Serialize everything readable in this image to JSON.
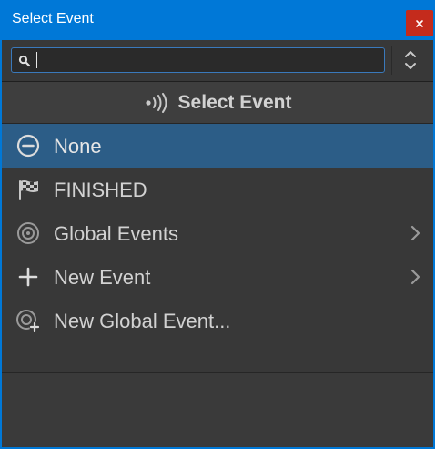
{
  "window": {
    "title": "Select Event",
    "close_icon": "close-icon"
  },
  "search": {
    "value": "",
    "placeholder": "",
    "icon": "search-icon"
  },
  "header": {
    "title": "Select Event",
    "icon": "broadcast-icon"
  },
  "items": [
    {
      "label": "None",
      "icon": "minus-circle-icon",
      "selected": true,
      "submenu": false
    },
    {
      "label": "FINISHED",
      "icon": "checkered-flag-icon",
      "selected": false,
      "submenu": false
    },
    {
      "label": "Global Events",
      "icon": "target-icon",
      "selected": false,
      "submenu": true
    },
    {
      "label": "New Event",
      "icon": "plus-icon",
      "selected": false,
      "submenu": true
    },
    {
      "label": "New Global Event...",
      "icon": "target-plus-icon",
      "selected": false,
      "submenu": false
    }
  ],
  "colors": {
    "titlebar": "#0078d7",
    "close": "#c42b1c",
    "panel": "#383838",
    "selected": "#2c5d87",
    "text": "#d2d2d2"
  }
}
